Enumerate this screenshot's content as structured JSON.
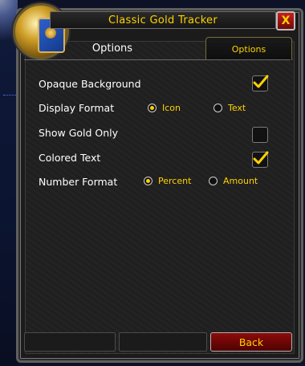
{
  "window": {
    "title": "Classic Gold Tracker",
    "close_label": "X"
  },
  "tabs": {
    "left": "Options",
    "active": "Options"
  },
  "options": [
    {
      "label": "Opaque Background",
      "type": "checkbox",
      "checked": true
    },
    {
      "label": "Display Format",
      "type": "radio",
      "choices": [
        "Icon",
        "Text"
      ],
      "selected": "Icon"
    },
    {
      "label": "Show Gold Only",
      "type": "checkbox",
      "checked": false
    },
    {
      "label": "Colored Text",
      "type": "checkbox",
      "checked": true
    },
    {
      "label": "Number Format",
      "type": "radio",
      "choices": [
        "Percent",
        "Amount"
      ],
      "selected": "Percent"
    }
  ],
  "footer": {
    "back_label": "Back"
  },
  "colors": {
    "accent_gold": "#ffd200",
    "frame_gray": "#5f5f5f",
    "button_red": "#8d0b0b"
  },
  "icons": {
    "portrait": "book-emblem-icon",
    "close": "close-icon",
    "check": "check-icon"
  }
}
